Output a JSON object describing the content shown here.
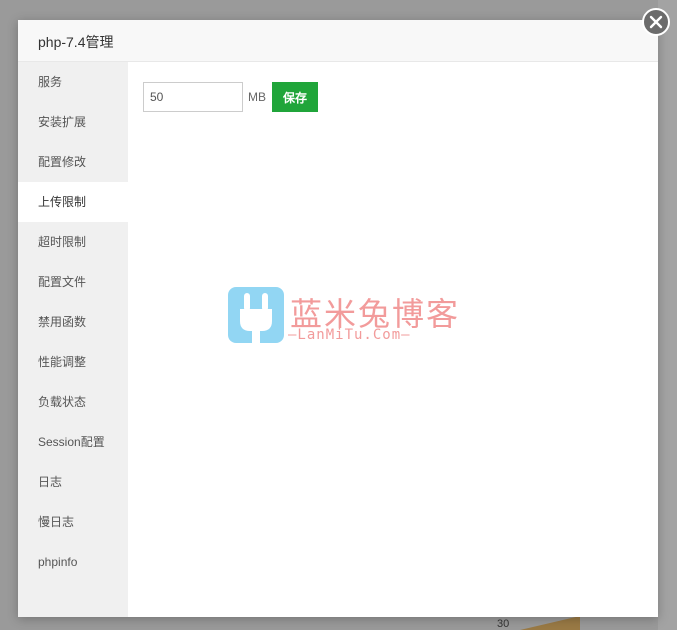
{
  "dialog": {
    "title": "php-7.4管理"
  },
  "sidebar": {
    "items": [
      {
        "label": "服务"
      },
      {
        "label": "安装扩展"
      },
      {
        "label": "配置修改"
      },
      {
        "label": "上传限制",
        "active": true
      },
      {
        "label": "超时限制"
      },
      {
        "label": "配置文件"
      },
      {
        "label": "禁用函数"
      },
      {
        "label": "性能调整"
      },
      {
        "label": "负载状态"
      },
      {
        "label": "Session配置"
      },
      {
        "label": "日志"
      },
      {
        "label": "慢日志"
      },
      {
        "label": "phpinfo"
      }
    ]
  },
  "upload_limit": {
    "value": "50",
    "unit": "MB",
    "save_label": "保存"
  },
  "watermark": {
    "title": "蓝米兔博客",
    "subtitle": "—LanMiTu.Com—"
  },
  "background": {
    "axis_label": "30"
  },
  "colors": {
    "accent": "#20a53a",
    "sidebar_bg": "#f0f0f0",
    "close_bg": "#6b6b6b"
  }
}
